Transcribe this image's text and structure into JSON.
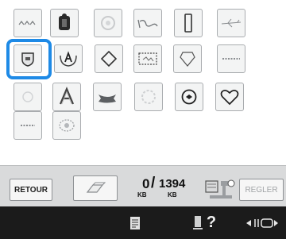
{
  "grid": {
    "rows": [
      [
        "dotted-band-icon",
        "monogram-block-icon",
        "faint-sun-icon",
        "cursive-script-icon",
        "tall-frame-icon",
        "airplane-sketch-icon"
      ],
      [
        "shield-plaque-icon",
        "crest-letter-a-icon",
        "diamond-outline-icon",
        "certificate-frame-icon",
        "heart-badge-outline-icon",
        "dotted-line-icon"
      ],
      [
        "faint-circle-icon",
        "ornate-letter-a-icon",
        "ribbon-banner-icon",
        "faint-ring-icon",
        "round-emblem-icon",
        "heart-outline-icon"
      ],
      [
        "dotted-short-icon",
        "ornamental-medallion-icon"
      ]
    ],
    "selected": "shield-plaque-icon"
  },
  "toolbar": {
    "retour_label": "RETOUR",
    "regler_label": "REGLER",
    "memory": {
      "used": "0",
      "separator": "/",
      "total": "1394",
      "unit": "KB",
      "unit_total": "KB"
    }
  },
  "bottom_bar": {
    "help_label": "?"
  }
}
